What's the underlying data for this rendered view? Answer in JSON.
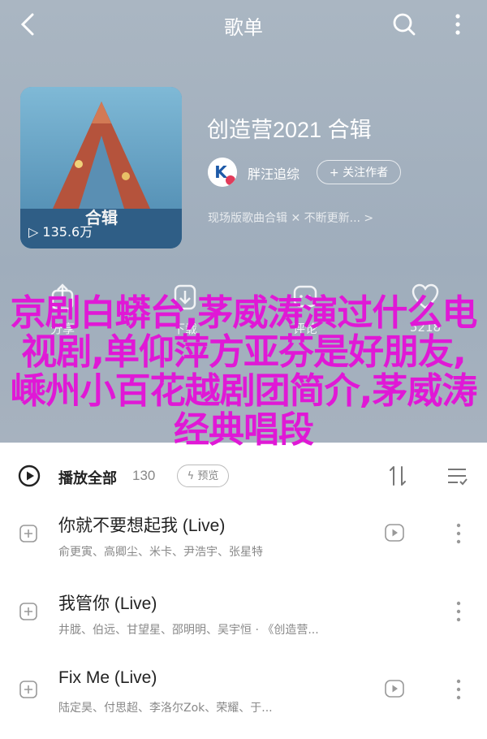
{
  "header": {
    "title": "歌单"
  },
  "album": {
    "cover_label": "合辑",
    "play_count": "135.6万",
    "title": "创造营2021 合辑",
    "creator": "胖汪追综",
    "follow": "+ 关注作者",
    "desc": "现场版歌曲合辑 ✕ 不断更新... >"
  },
  "actions": [
    {
      "label": "分享"
    },
    {
      "label": "下载"
    },
    {
      "label": "评论"
    },
    {
      "label": "5218"
    }
  ],
  "overlay_text": "京剧白蟒台,茅威涛演过什么电视剧,单仰萍方亚芬是好朋友,嵊州小百花越剧团简介,茅威涛经典唱段",
  "list": {
    "play_all": "播放全部",
    "count": "130",
    "preview": "预览",
    "songs": [
      {
        "name": "你就不要想起我 (Live)",
        "artists": "俞更寅、高卿尘、米卡、尹浩宇、张星特"
      },
      {
        "name": "我管你 (Live)",
        "artists": "井胧、伯远、甘望星、邵明明、吴宇恒 · 《创造营..."
      },
      {
        "name": "Fix Me (Live)",
        "artists": "陆定昊、付思超、李洛尔Zok、荣耀、于..."
      }
    ]
  },
  "colors": {
    "overlay": "#e018d6",
    "header_bg": "#a6b3c1"
  }
}
